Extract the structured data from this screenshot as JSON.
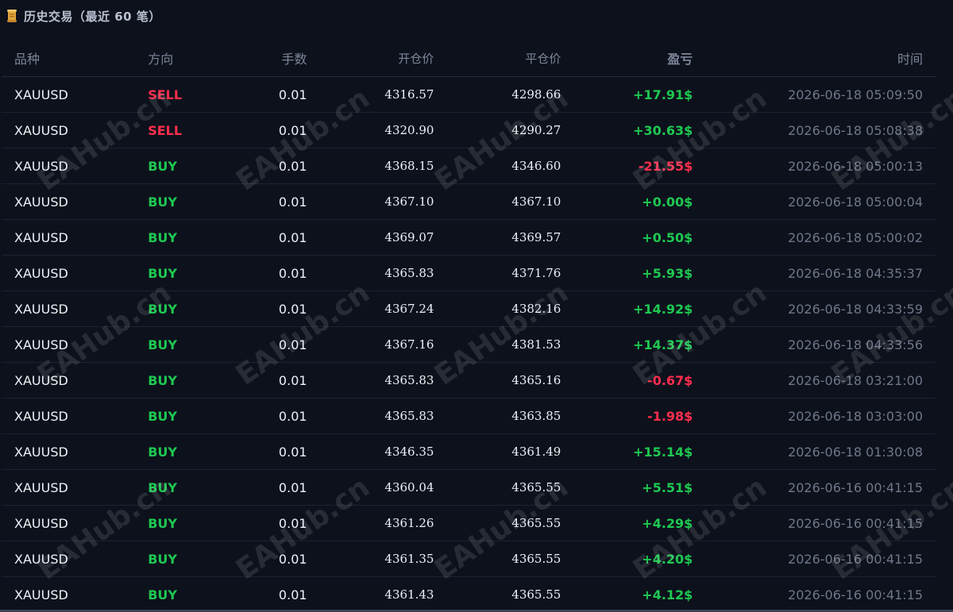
{
  "header": {
    "icon": "scroll-icon",
    "title": "历史交易（最近 60 笔）"
  },
  "columns": {
    "symbol": "品种",
    "direction": "方向",
    "lots": "手数",
    "open_price": "开仓价",
    "close_price": "平仓价",
    "profit": "盈亏",
    "time": "时间"
  },
  "watermark": {
    "text": "EAHub.cn"
  },
  "colors": {
    "buy": "#1ec851",
    "sell": "#ff2e4d",
    "background": "#0d111c"
  },
  "trades": [
    {
      "symbol": "XAUUSD",
      "direction": "SELL",
      "lots": "0.01",
      "open": "4316.57",
      "close": "4298.66",
      "pl": "+17.91$",
      "time": "2026-06-18 05:09:50"
    },
    {
      "symbol": "XAUUSD",
      "direction": "SELL",
      "lots": "0.01",
      "open": "4320.90",
      "close": "4290.27",
      "pl": "+30.63$",
      "time": "2026-06-18 05:08:38"
    },
    {
      "symbol": "XAUUSD",
      "direction": "BUY",
      "lots": "0.01",
      "open": "4368.15",
      "close": "4346.60",
      "pl": "-21.55$",
      "time": "2026-06-18 05:00:13"
    },
    {
      "symbol": "XAUUSD",
      "direction": "BUY",
      "lots": "0.01",
      "open": "4367.10",
      "close": "4367.10",
      "pl": "+0.00$",
      "time": "2026-06-18 05:00:04"
    },
    {
      "symbol": "XAUUSD",
      "direction": "BUY",
      "lots": "0.01",
      "open": "4369.07",
      "close": "4369.57",
      "pl": "+0.50$",
      "time": "2026-06-18 05:00:02"
    },
    {
      "symbol": "XAUUSD",
      "direction": "BUY",
      "lots": "0.01",
      "open": "4365.83",
      "close": "4371.76",
      "pl": "+5.93$",
      "time": "2026-06-18 04:35:37"
    },
    {
      "symbol": "XAUUSD",
      "direction": "BUY",
      "lots": "0.01",
      "open": "4367.24",
      "close": "4382.16",
      "pl": "+14.92$",
      "time": "2026-06-18 04:33:59"
    },
    {
      "symbol": "XAUUSD",
      "direction": "BUY",
      "lots": "0.01",
      "open": "4367.16",
      "close": "4381.53",
      "pl": "+14.37$",
      "time": "2026-06-18 04:33:56"
    },
    {
      "symbol": "XAUUSD",
      "direction": "BUY",
      "lots": "0.01",
      "open": "4365.83",
      "close": "4365.16",
      "pl": "-0.67$",
      "time": "2026-06-18 03:21:00"
    },
    {
      "symbol": "XAUUSD",
      "direction": "BUY",
      "lots": "0.01",
      "open": "4365.83",
      "close": "4363.85",
      "pl": "-1.98$",
      "time": "2026-06-18 03:03:00"
    },
    {
      "symbol": "XAUUSD",
      "direction": "BUY",
      "lots": "0.01",
      "open": "4346.35",
      "close": "4361.49",
      "pl": "+15.14$",
      "time": "2026-06-18 01:30:08"
    },
    {
      "symbol": "XAUUSD",
      "direction": "BUY",
      "lots": "0.01",
      "open": "4360.04",
      "close": "4365.55",
      "pl": "+5.51$",
      "time": "2026-06-16 00:41:15"
    },
    {
      "symbol": "XAUUSD",
      "direction": "BUY",
      "lots": "0.01",
      "open": "4361.26",
      "close": "4365.55",
      "pl": "+4.29$",
      "time": "2026-06-16 00:41:15"
    },
    {
      "symbol": "XAUUSD",
      "direction": "BUY",
      "lots": "0.01",
      "open": "4361.35",
      "close": "4365.55",
      "pl": "+4.20$",
      "time": "2026-06-16 00:41:15"
    },
    {
      "symbol": "XAUUSD",
      "direction": "BUY",
      "lots": "0.01",
      "open": "4361.43",
      "close": "4365.55",
      "pl": "+4.12$",
      "time": "2026-06-16 00:41:15"
    }
  ]
}
